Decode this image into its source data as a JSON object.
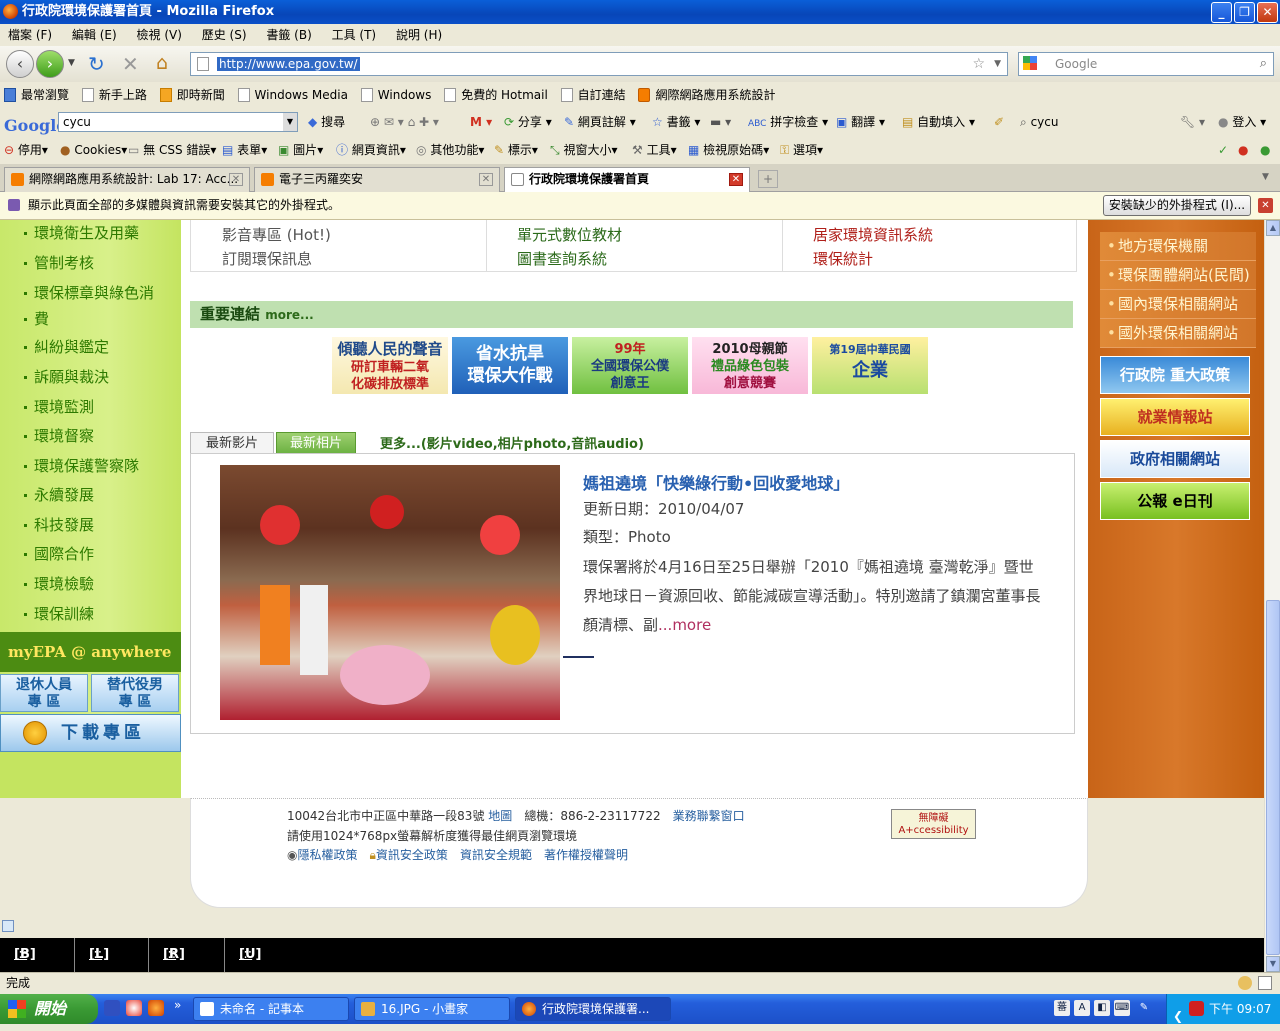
{
  "window": {
    "title": "行政院環境保護署首頁 - Mozilla Firefox"
  },
  "menu": [
    "檔案 (F)",
    "編輯 (E)",
    "檢視 (V)",
    "歷史 (S)",
    "書籤 (B)",
    "工具 (T)",
    "說明 (H)"
  ],
  "nav": {
    "url": "http://www.epa.gov.tw/",
    "search_placeholder": "Google"
  },
  "bookmarks": [
    "最常瀏覽",
    "新手上路",
    "即時新聞",
    "Windows Media",
    "Windows",
    "免費的 Hotmail",
    "自訂連結",
    "網際網路應用系統設計"
  ],
  "googlebar": {
    "logo": "Google",
    "query": "cycu",
    "search": "搜尋",
    "share": "分享",
    "notes": "網頁註解",
    "bookmarks": "書籤",
    "spell": "拼字檢查",
    "translate": "翻譯",
    "autofill": "自動填入",
    "user": "cycu",
    "login": "登入"
  },
  "webdev": [
    "停用",
    "Cookies",
    "無 CSS 錯誤",
    "表單",
    "圖片",
    "網頁資訊",
    "其他功能",
    "標示",
    "視窗大小",
    "工具",
    "檢視原始碼",
    "選項"
  ],
  "tabs": [
    {
      "label": "網際網路應用系統設計: Lab 17: Acc..."
    },
    {
      "label": "電子三丙羅奕安"
    },
    {
      "label": "行政院環境保護署首頁"
    }
  ],
  "infobar": {
    "message": "顯示此頁面全部的多媒體與資訊需要安裝其它的外掛程式。",
    "button": "安裝缺少的外掛程式 (I)..."
  },
  "leftnav": {
    "items": [
      "環境衛生及用藥",
      "管制考核",
      "環保標章與綠色消",
      "費",
      "糾紛與鑑定",
      "訴願與裁決",
      "環境監測",
      "環境督察",
      "環境保護警察隊",
      "永續發展",
      "科技發展",
      "國際合作",
      "環境檢驗",
      "環保訓練"
    ],
    "myepa": "myEPA @ anywhere",
    "btn_retired": [
      "退休人員",
      "專 區"
    ],
    "btn_substitute": [
      "替代役男",
      "專 區"
    ],
    "download": "下載專區"
  },
  "toptable": {
    "col1": [
      "影音專區 (Hot!)",
      "訂閱環保訊息"
    ],
    "col2": [
      "單元式數位教材",
      "圖書查詢系統"
    ],
    "col3": [
      "居家環境資訊系統",
      "環保統計"
    ]
  },
  "links": {
    "heading": "重要連結",
    "more": "more...",
    "banners": [
      {
        "line1": "傾聽人民的聲音",
        "line2": "研訂車輛二氧",
        "line3": "化碳排放標準"
      },
      {
        "line1": "省水抗旱",
        "line2": "環保大作戰"
      },
      {
        "line1": "99年",
        "line2": "全國環保公僕",
        "line3": "創意王"
      },
      {
        "line1": "2010母親節",
        "line2": "禮品綠色包裝",
        "line3": "創意競賽"
      },
      {
        "line1": "第19屆中華民國",
        "line2": "企業"
      }
    ]
  },
  "media": {
    "tab_video": "最新影片",
    "tab_photo": "最新相片",
    "more": "更多...(影片video,相片photo,音訊audio)",
    "news_title": "媽祖遶境「快樂綠行動•回收愛地球」",
    "date_line": "更新日期：2010/04/07",
    "type_line": "類型：Photo",
    "body": "環保署將於4月16日至25日舉辦「2010『媽祖遶境 臺灣乾淨』暨世界地球日－資源回收、節能減碳宣導活動」。特別邀請了鎮瀾宮董事長顏清標、副",
    "readmore": "...more"
  },
  "rightcol": {
    "links": [
      "地方環保機關",
      "環保團體網站(民間)",
      "國內環保相關網站",
      "國外環保相關網站"
    ],
    "banners": [
      "行政院 重大政策",
      "就業情報站",
      "政府相關網站",
      "公報 e日刊"
    ]
  },
  "footer": {
    "address": "10042台北市中正區中華路一段83號",
    "map": "地圖",
    "phone": "總機：886-2-23117722",
    "contact": "業務聯繫窗口",
    "resolution": "請使用1024*768px螢幕解析度獲得最佳網頁瀏覽環境",
    "privacy": "隱私權政策",
    "security": "資訊安全政策",
    "norms": "資訊安全規範",
    "copyright": "著作權授權聲明",
    "access_badge": "無障礙 A+ccessibility"
  },
  "accesskeys": [
    {
      "k": "[B]",
      "v": ":::"
    },
    {
      "k": "[L]",
      "v": ":::"
    },
    {
      "k": "[R]",
      "v": ":::"
    },
    {
      "k": "[U]",
      "v": ":::"
    }
  ],
  "status": "完成",
  "taskbar": {
    "start": "開始",
    "tasks": [
      "未命名 - 記事本",
      "16.JPG - 小畫家",
      "行政院環境保護署..."
    ],
    "clock": "下午 09:07"
  }
}
